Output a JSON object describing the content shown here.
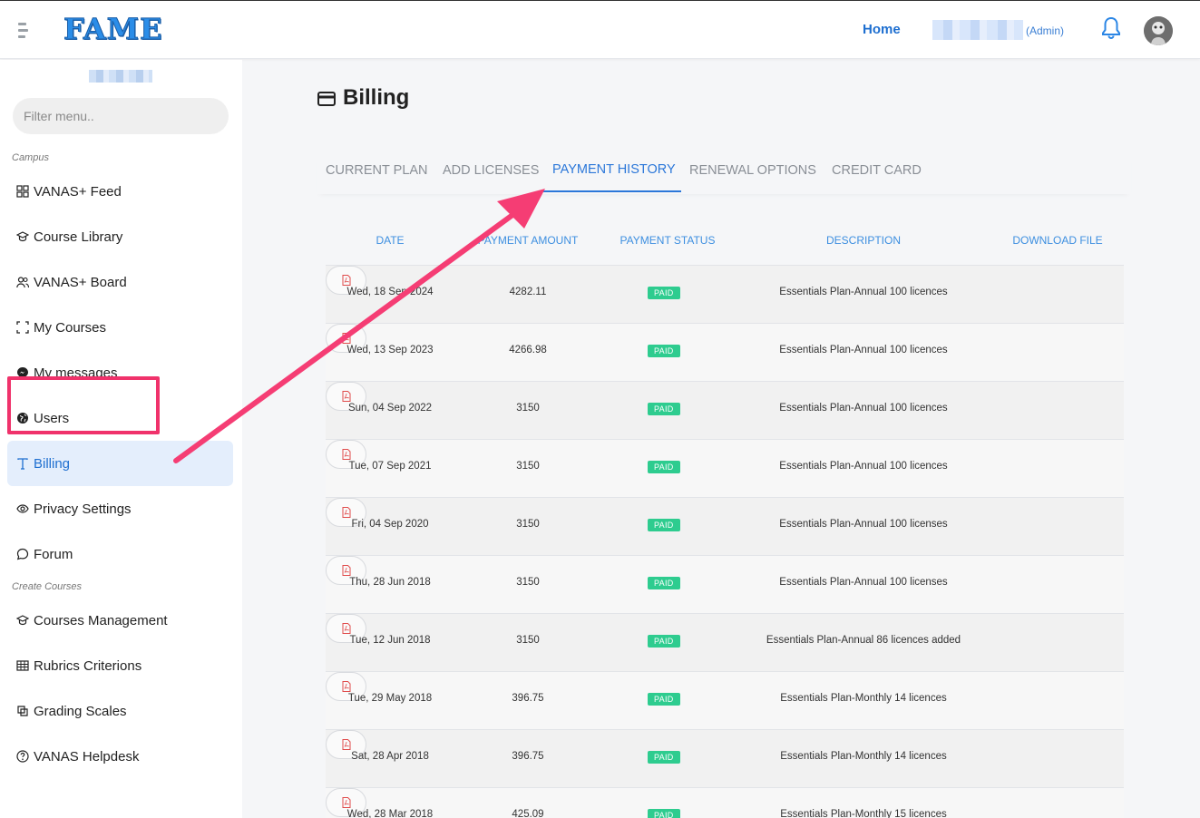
{
  "header": {
    "logo": "FAME",
    "home_label": "Home",
    "role_label": "(Admin)"
  },
  "sidebar": {
    "filter_placeholder": "Filter menu..",
    "sections": {
      "campus": "Campus",
      "create_courses": "Create Courses"
    },
    "items": [
      {
        "label": "VANAS+ Feed",
        "icon": "grid-icon"
      },
      {
        "label": "Course Library",
        "icon": "graduation-cap-icon"
      },
      {
        "label": "VANAS+ Board",
        "icon": "users-icon"
      },
      {
        "label": "My Courses",
        "icon": "expand-icon"
      },
      {
        "label": "My messages",
        "icon": "messenger-icon"
      },
      {
        "label": "Users",
        "icon": "globe-icon"
      },
      {
        "label": "Billing",
        "icon": "text-t-icon"
      },
      {
        "label": "Privacy Settings",
        "icon": "eye-icon"
      },
      {
        "label": "Forum",
        "icon": "chat-bubble-icon"
      },
      {
        "label": "Courses Management",
        "icon": "graduation-cap-icon"
      },
      {
        "label": "Rubrics Criterions",
        "icon": "table-icon"
      },
      {
        "label": "Grading Scales",
        "icon": "scale-icon"
      },
      {
        "label": "VANAS Helpdesk",
        "icon": "help-circle-icon"
      }
    ],
    "active_item": "Billing"
  },
  "page": {
    "title": "Billing",
    "tabs": [
      "CURRENT PLAN",
      "ADD LICENSES",
      "PAYMENT HISTORY",
      "RENEWAL OPTIONS",
      "CREDIT CARD"
    ],
    "active_tab": "PAYMENT HISTORY"
  },
  "table": {
    "headers": [
      "DATE",
      "PAYMENT AMOUNT",
      "PAYMENT STATUS",
      "DESCRIPTION",
      "DOWNLOAD FILE"
    ],
    "rows": [
      {
        "date": "Wed, 18 Sep 2024",
        "amount": "4282.11",
        "status": "PAID",
        "description": "Essentials Plan-Annual 100 licences"
      },
      {
        "date": "Wed, 13 Sep 2023",
        "amount": "4266.98",
        "status": "PAID",
        "description": "Essentials Plan-Annual 100 licences"
      },
      {
        "date": "Sun, 04 Sep 2022",
        "amount": "3150",
        "status": "PAID",
        "description": "Essentials Plan-Annual 100 licences"
      },
      {
        "date": "Tue, 07 Sep 2021",
        "amount": "3150",
        "status": "PAID",
        "description": "Essentials Plan-Annual 100 licences"
      },
      {
        "date": "Fri, 04 Sep 2020",
        "amount": "3150",
        "status": "PAID",
        "description": "Essentials Plan-Annual 100 licenses"
      },
      {
        "date": "Thu, 28 Jun 2018",
        "amount": "3150",
        "status": "PAID",
        "description": "Essentials Plan-Annual 100 licenses"
      },
      {
        "date": "Tue, 12 Jun 2018",
        "amount": "3150",
        "status": "PAID",
        "description": "Essentials Plan-Annual 86 licences added"
      },
      {
        "date": "Tue, 29 May 2018",
        "amount": "396.75",
        "status": "PAID",
        "description": "Essentials Plan-Monthly 14 licences"
      },
      {
        "date": "Sat, 28 Apr 2018",
        "amount": "396.75",
        "status": "PAID",
        "description": "Essentials Plan-Monthly 14 licences"
      },
      {
        "date": "Wed, 28 Mar 2018",
        "amount": "425.09",
        "status": "PAID",
        "description": "Essentials Plan-Monthly 15 licences"
      }
    ]
  },
  "colors": {
    "accent": "#1e6fd0",
    "paid_badge": "#2ecc8f",
    "annotation": "#f0326b"
  }
}
